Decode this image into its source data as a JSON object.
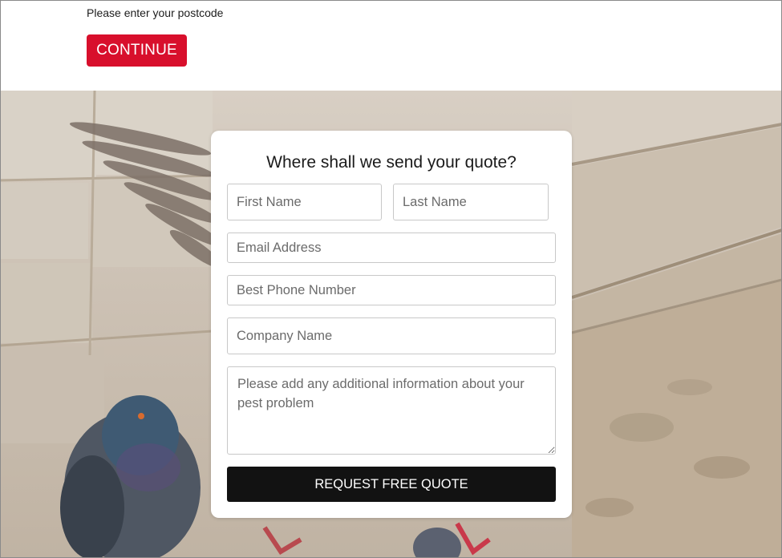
{
  "postcode": {
    "label": "Please enter your postcode",
    "continue_label": "CONTINUE"
  },
  "quote_form": {
    "title": "Where shall we send your quote?",
    "first_name_placeholder": "First Name",
    "last_name_placeholder": "Last Name",
    "email_placeholder": "Email Address",
    "phone_placeholder": "Best Phone Number",
    "company_placeholder": "Company Name",
    "info_placeholder": "Please add any additional information about your pest problem",
    "submit_label": "REQUEST FREE QUOTE"
  },
  "colors": {
    "accent": "#d80f2c",
    "submit": "#121212"
  }
}
